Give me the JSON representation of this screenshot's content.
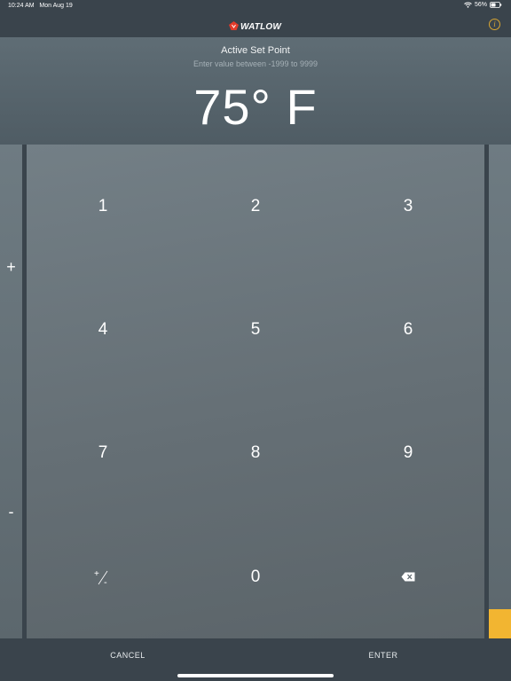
{
  "status": {
    "time": "10:24 AM",
    "date": "Mon Aug 19",
    "battery": "56%",
    "battery_level": 0.56
  },
  "nav": {
    "brand": "WATLOW",
    "info_icon": "info-icon"
  },
  "header": {
    "title": "Active Set Point",
    "hint": "Enter value between -1999 to 9999",
    "value": "75° F"
  },
  "stepper": {
    "up": "+",
    "down": "-"
  },
  "keypad": {
    "keys": [
      "1",
      "2",
      "3",
      "4",
      "5",
      "6",
      "7",
      "8",
      "9",
      "0"
    ],
    "sign_plus": "+",
    "sign_minus": "-",
    "backspace_icon": "backspace-icon"
  },
  "level": {
    "fraction": 0.06,
    "color": "#f2b531"
  },
  "actions": {
    "cancel": "CANCEL",
    "enter": "ENTER"
  },
  "colors": {
    "accent": "#f2b531",
    "info": "#d9a632",
    "bar": "#3a444c"
  }
}
